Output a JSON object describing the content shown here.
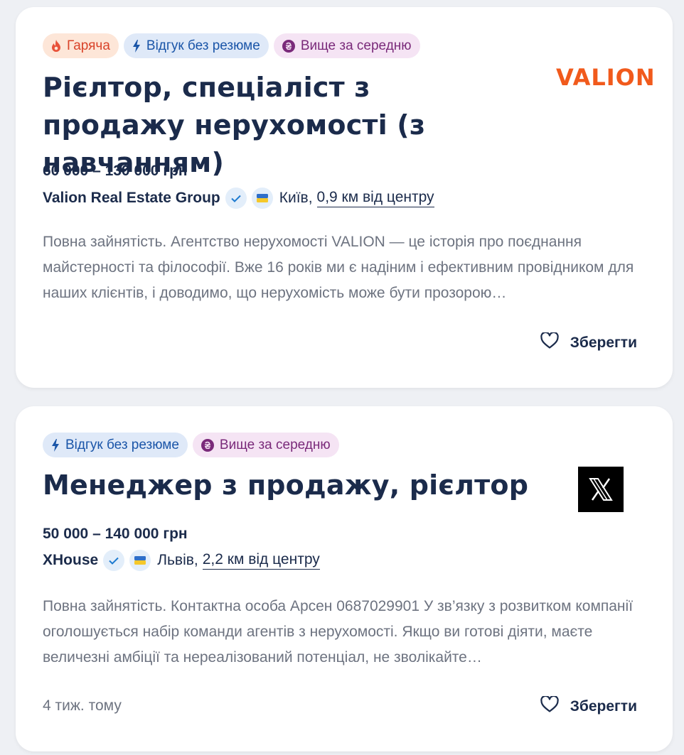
{
  "jobs": [
    {
      "tags": {
        "hot": "Гаряча",
        "no_resume": "Відгук без резюме",
        "above_avg": "Вище за середню"
      },
      "title": "Рієлтор, спеціаліст з продажу нерухомості (з навчанням)",
      "salary": "60 000 – 130 000 грн",
      "company": "Valion Real Estate Group",
      "city": "Київ,",
      "distance": "0,9 км від центру",
      "description": "Повна зайнятість. Агентство нерухомості VALION — це історія про поєднання майстерності та філософії. Вже 16 років ми є надіним і ефективним провідником для наших клієнтів, і доводимо, що нерухомість може бути прозорою…",
      "save_label": "Зберегти",
      "logo_text": "VALION"
    },
    {
      "tags": {
        "no_resume": "Відгук без резюме",
        "above_avg": "Вище за середню"
      },
      "title": "Менеджер з продажу, рієлтор",
      "salary": "50 000 – 140 000 грн",
      "company": "XHouse",
      "city": "Львів,",
      "distance": "2,2 км від центру",
      "description": "Повна зайнятість. Контактна особа Арсен 0687029901 У зв’язку з розвитком компанії оголошується набір команди агентів з нерухомості. Якщо ви готові діяти, маєте величезні амбіції та нереалізований потенціал, не зволікайте…",
      "posted": "4 тиж. тому",
      "save_label": "Зберегти"
    }
  ],
  "colors": {
    "hot_bg": "#fde6d8",
    "hot_fg": "#d9442a",
    "no_resume_bg": "#dfe9f8",
    "no_resume_fg": "#1a55a8",
    "above_bg": "#f5e4f4",
    "above_fg": "#7a2a7a",
    "valion_brand": "#f15a1c"
  },
  "icons": {
    "hot": "flame-icon",
    "no_resume": "lightning-icon",
    "above_avg": "hryvnia-coin-icon",
    "verified": "check-icon",
    "flag": "ukraine-flag-icon",
    "save": "heart-icon"
  }
}
